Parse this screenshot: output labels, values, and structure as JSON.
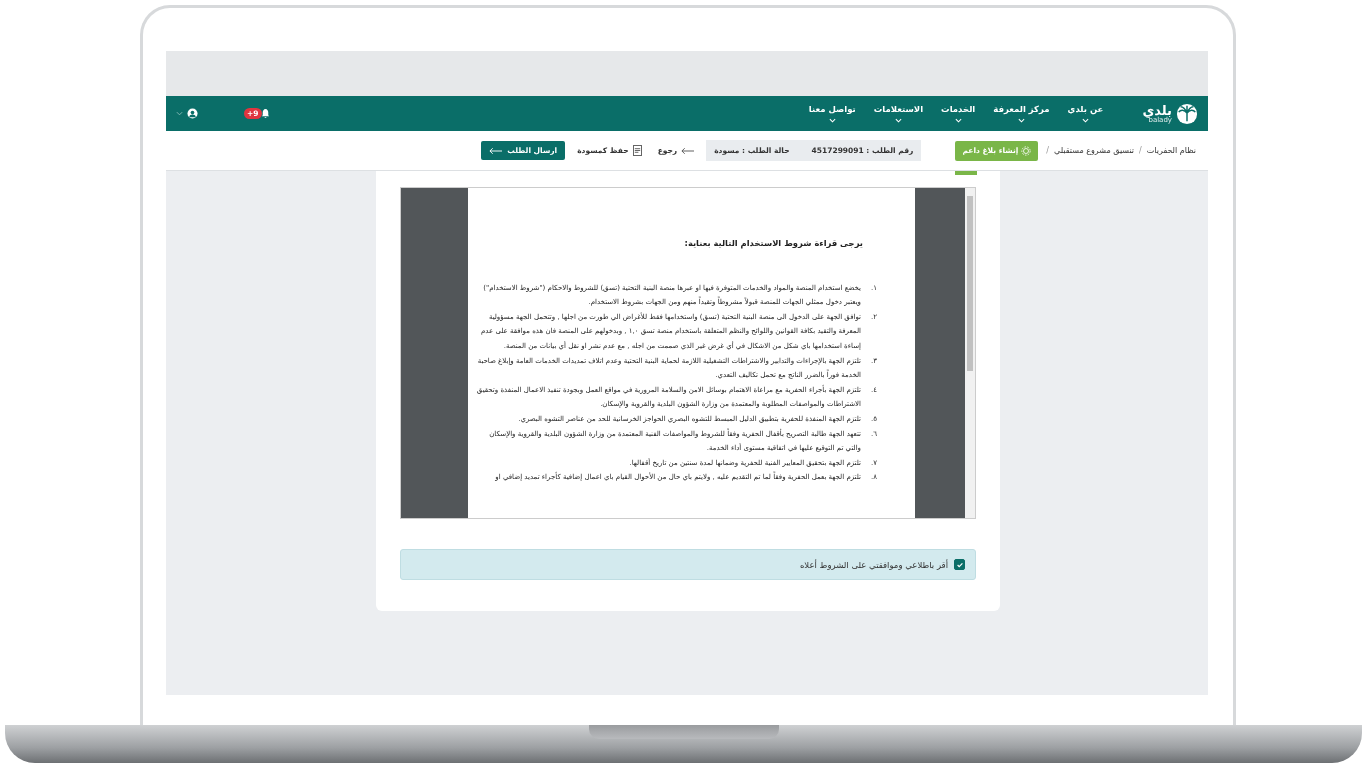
{
  "header": {
    "logo": {
      "text": "بلدي",
      "subtitle": "balady"
    },
    "nav": [
      {
        "label": "عن بلدي"
      },
      {
        "label": "مركز المعرفة"
      },
      {
        "label": "الخدمات"
      },
      {
        "label": "الاستعلامات"
      },
      {
        "label": "تواصل معنا"
      }
    ],
    "notifications_badge": "+9"
  },
  "toolbar": {
    "breadcrumb": [
      {
        "label": "نظام الحفريات",
        "separator": "/"
      },
      {
        "label": "تنسيق مشروع مستقبلي",
        "separator": "/"
      }
    ],
    "report_button": "إنشاء بلاغ داعم",
    "request_number": "رقم الطلب : 4517299091",
    "request_status": "حالة الطلب : مسودة",
    "back": "رجوع",
    "save_draft": "حفظ كمسودة",
    "submit": "ارسال الطلب"
  },
  "terms": {
    "heading": "يرجى قراءة شروط الاستخدام التالية بعناية:",
    "items": [
      {
        "number": "١.",
        "text": "يخضع استخدام المنصة والمواد والخدمات المتوفرة فيها او عبرها منصة البنية التحتية (تسق) للشروط والاحكام (\"شروط الاستخدام\") ويعتبر دخول ممثلي الجهات للمنصة قبولاً مشروطاً وتقيداً منهم ومن الجهات بشروط الاستخدام."
      },
      {
        "number": "٢.",
        "text": "توافق الجهة على الدخول الى منصة البنية التحتية (تسق) واستخدامها فقط للأغراض الي طورت من اجلها , وتتحمل الجهة مسؤولية المعرفة والتقيد بكافة القوانين واللوائح والنظم المتعلقة باستخدام منصة تسق ١,٠ , وبدخولهم على المنصة فان هذه موافقة على عدم إساءة استخدامها باي شكل من الاشكال في أي غرض غير الذي صممت من اجله , مع عدم نشر او نقل أي بيانات من المنصة."
      },
      {
        "number": "٣.",
        "text": "تلتزم الجهة بالإجراءات والتدابير والاشتراطات التشغيلية اللازمة لحماية البنية التحتية وعدم اتلاف تمديدات الخدمات العامة وإبلاغ صاحبة الخدمة فوراً بالضرر الناتج مع تحمل تكاليف التعدي."
      },
      {
        "number": "٤.",
        "text": "تلتزم الجهة بأجراء الحفرية مع مراعاة الاهتمام بوسائل الامن والسلامة المرورية في مواقع العمل وبجودة تنفيذ الاعمال المنفذة وتحقيق الاشتراطات والمواصفات المطلوبة والمعتمدة من وزارة الشؤون البلدية والقروية والإسكان."
      },
      {
        "number": "٥.",
        "text": "تلتزم الجهة المنفذة للحفرية بتطبيق الدليل المبسط للتشوه البصري الحواجز الخرسانية للحد من عناصر التشوه البصري."
      },
      {
        "number": "٦.",
        "text": "تتعهد الجهة طالبة التصريح بأقفال الحفرية وفقاً للشروط والمواصفات الفنية المعتمدة من وزارة الشؤون البلدية والقروية والإسكان والتي تم التوقيع عليها في اتفاقية مستوى أداء الخدمة."
      },
      {
        "number": "٧.",
        "text": "تلتزم الجهة بتحقيق المعايير الفنية للحفرية وضمانها لمدة سنتين من تاريخ أقفالها."
      },
      {
        "number": "٨.",
        "text": "تلتزم الجهة بعمل الحفرية وفقاً لما تم التقديم عليه , ولايتم باي حال من الأحوال القيام باي اعمال إضافية كأجراء تمديد إضافي او"
      }
    ]
  },
  "agreement": {
    "label": "أقر باطلاعي وموافقتي على الشروط أعلاه",
    "checked": true
  }
}
